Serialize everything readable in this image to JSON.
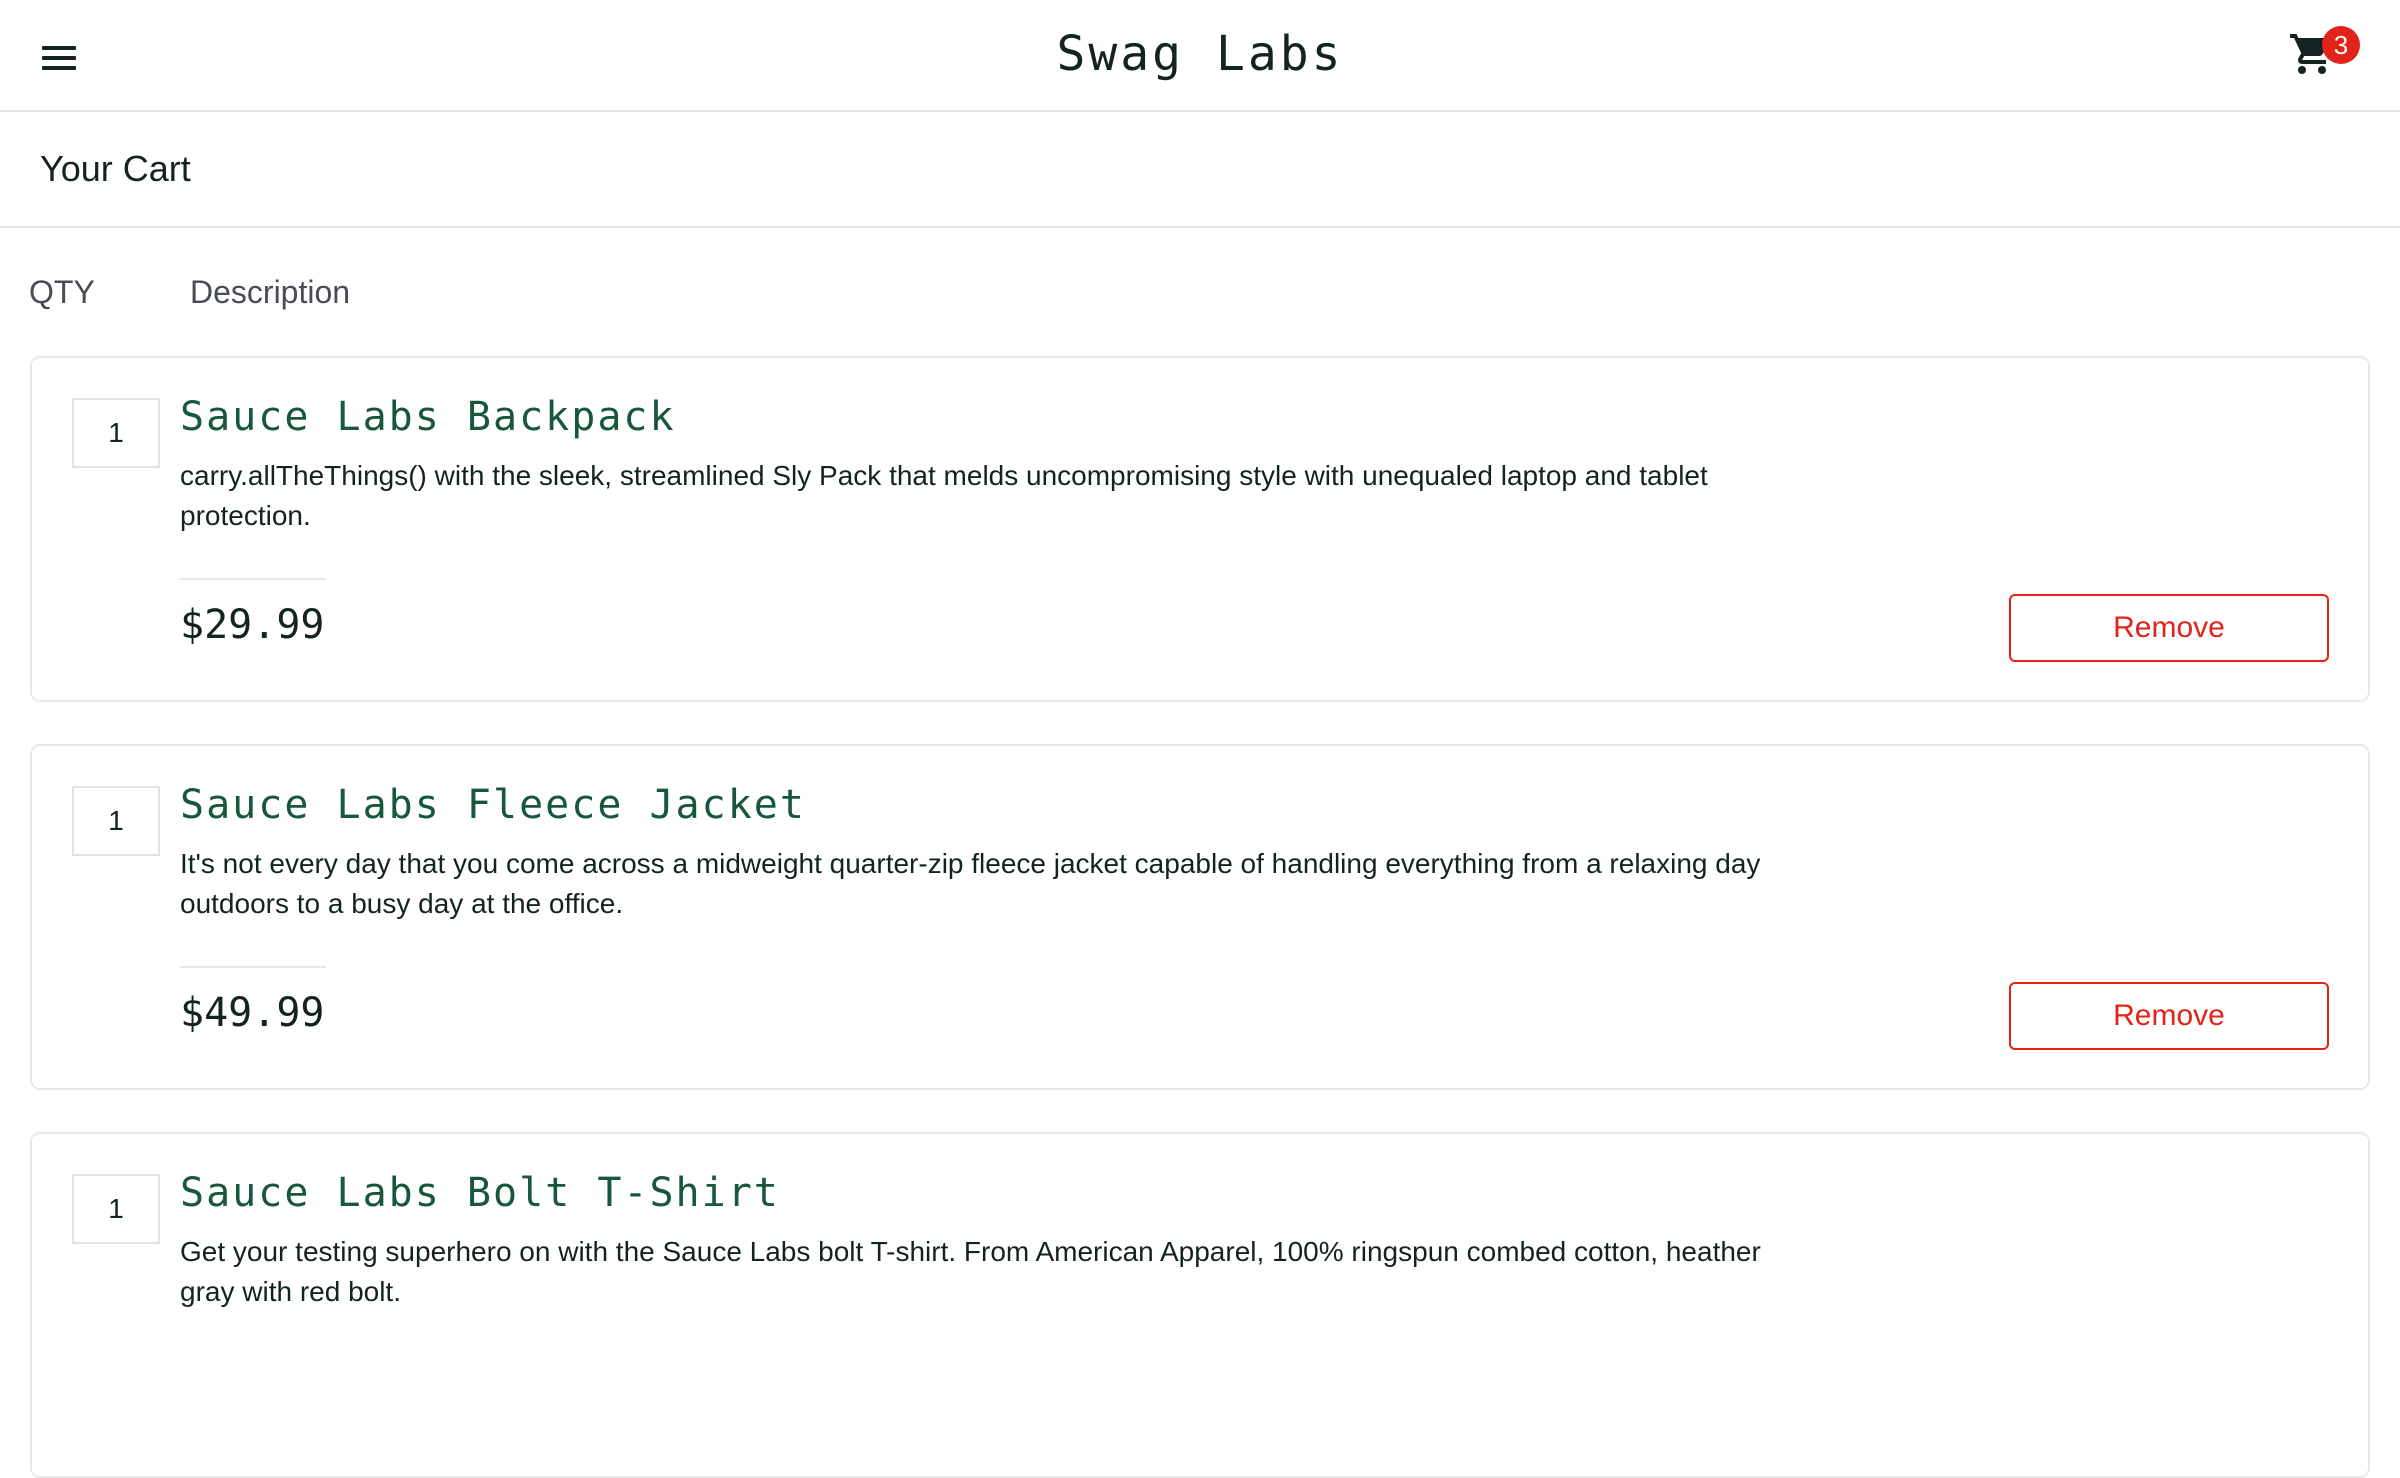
{
  "header": {
    "title": "Swag Labs",
    "menu_icon": "hamburger-menu-icon",
    "cart_icon": "shopping-cart-icon",
    "cart_count": "3"
  },
  "page": {
    "title": "Your Cart"
  },
  "columns": {
    "qty": "QTY",
    "description": "Description"
  },
  "items": [
    {
      "qty": "1",
      "name": "Sauce Labs Backpack",
      "description": "carry.allTheThings() with the sleek, streamlined Sly Pack that melds uncompromising style with unequaled laptop and tablet protection.",
      "price": "$29.99",
      "remove_label": "Remove"
    },
    {
      "qty": "1",
      "name": "Sauce Labs Fleece Jacket",
      "description": "It's not every day that you come across a midweight quarter-zip fleece jacket capable of handling everything from a relaxing day outdoors to a busy day at the office.",
      "price": "$49.99",
      "remove_label": "Remove"
    },
    {
      "qty": "1",
      "name": "Sauce Labs Bolt T-Shirt",
      "description": "Get your testing superhero on with the Sauce Labs bolt T-shirt. From American Apparel, 100% ringspun combed cotton, heather gray with red bolt.",
      "price": "",
      "remove_label": ""
    }
  ],
  "colors": {
    "accent_red": "#e2231a",
    "item_name_green": "#18583a",
    "text_dark": "#132322"
  }
}
